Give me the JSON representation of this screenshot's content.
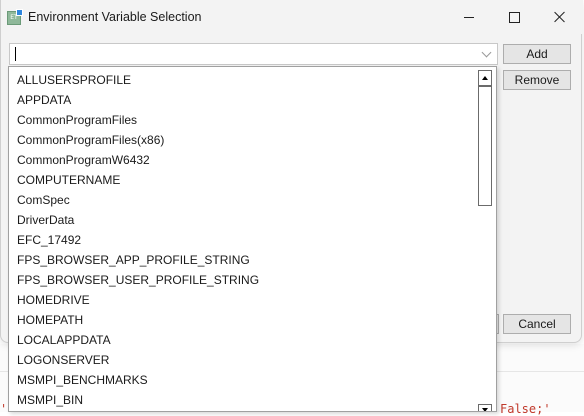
{
  "window": {
    "title": "Environment Variable Selection",
    "icon": "environment-variables-app-icon",
    "controls": [
      "minimize-icon",
      "maximize-icon",
      "close-icon"
    ]
  },
  "combo": {
    "value": "",
    "placeholder": "",
    "icon": "chevron-down-icon"
  },
  "buttons": {
    "add": "Add",
    "remove": "Remove",
    "cancel": "Cancel"
  },
  "dropdown": {
    "items": [
      "ALLUSERSPROFILE",
      "APPDATA",
      "CommonProgramFiles",
      "CommonProgramFiles(x86)",
      "CommonProgramW6432",
      "COMPUTERNAME",
      "ComSpec",
      "DriverData",
      "EFC_17492",
      "FPS_BROWSER_APP_PROFILE_STRING",
      "FPS_BROWSER_USER_PROFILE_STRING",
      "HOMEDRIVE",
      "HOMEPATH",
      "LOCALAPPDATA",
      "LOGONSERVER",
      "MSMPI_BENCHMARKS",
      "MSMPI_BIN"
    ],
    "scroll_position": 0.0
  },
  "background_editor": {
    "fragment_left": "'",
    "fragment_right": "False;'"
  },
  "colors": {
    "window_bg": "#f3f3f3",
    "list_bg": "#ffffff",
    "button_bg": "#e5e5e5",
    "editor_text": "#c0392b"
  }
}
